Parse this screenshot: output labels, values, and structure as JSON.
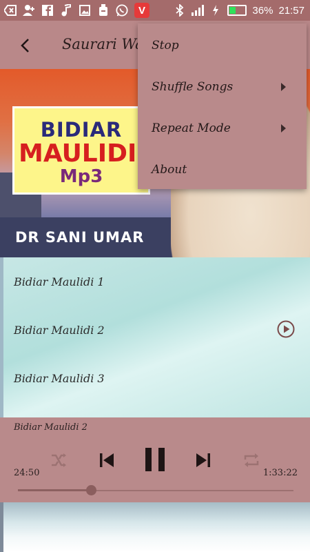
{
  "status_bar": {
    "battery": "36%",
    "time": "21:57",
    "battery_level": 0.36,
    "icons": [
      "back-arrow-box-icon",
      "add-contact-icon",
      "facebook-icon",
      "music-note-icon",
      "image-icon",
      "bucket-icon",
      "whatsapp-icon",
      "vivo-app-icon",
      "bluetooth-icon",
      "signal-icon",
      "charging-icon",
      "battery-icon"
    ],
    "vivo_letter": "V"
  },
  "toolbar": {
    "title": "Saurari Wa'"
  },
  "banner": {
    "logo_line1": "BIDIAR",
    "logo_line2": "MAULIDI",
    "logo_line3": "Mp3",
    "caption": "DR SANI UMAR"
  },
  "songs": [
    {
      "title": "Bidiar Maulidi 1"
    },
    {
      "title": "Bidiar Maulidi 2"
    },
    {
      "title": "Bidiar Maulidi 3"
    }
  ],
  "player": {
    "now_playing": "Bidiar Maulidi 2",
    "elapsed": "24:50",
    "duration": "1:33:22",
    "progress": 0.265
  },
  "menu": {
    "items": [
      {
        "label": "Stop",
        "has_submenu": false
      },
      {
        "label": "Shuffle Songs",
        "has_submenu": true
      },
      {
        "label": "Repeat Mode",
        "has_submenu": true
      },
      {
        "label": "About",
        "has_submenu": false
      }
    ]
  },
  "colors": {
    "status_bar": "#a46b6b",
    "toolbar": "#b98889",
    "player": "#b98a8b",
    "accent": "#8b5e5e"
  }
}
